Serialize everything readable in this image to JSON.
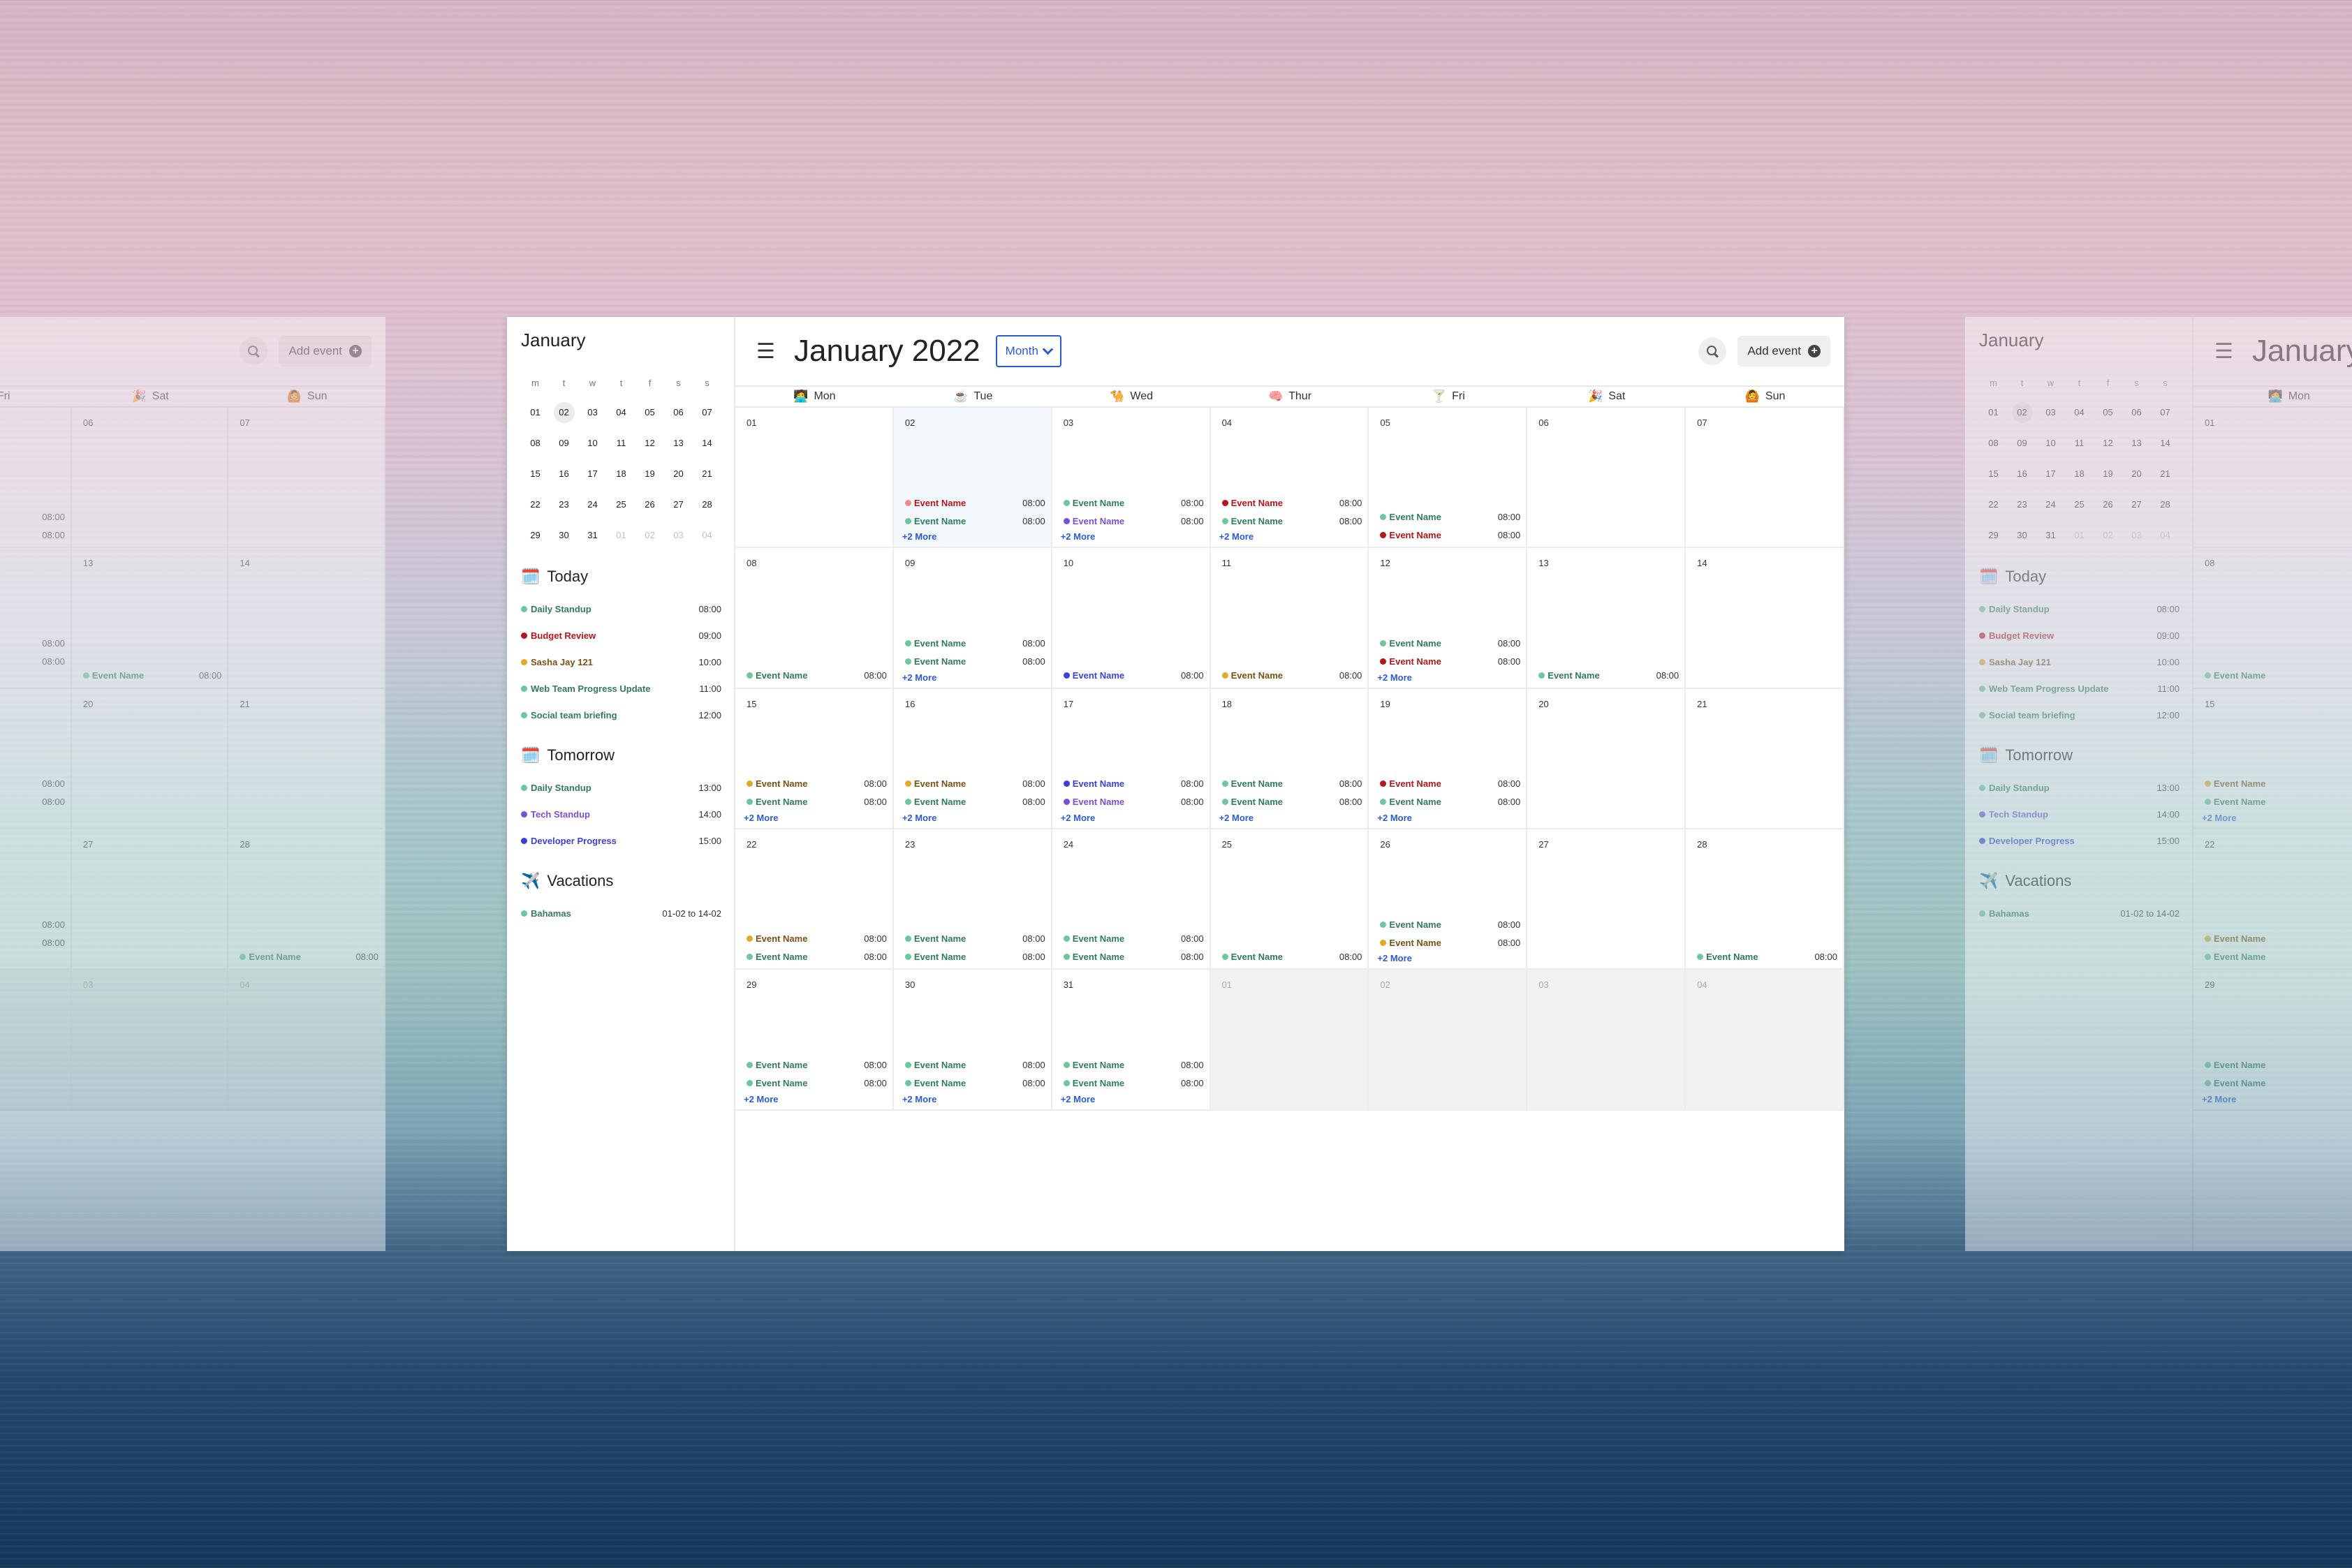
{
  "app": {
    "title": "January 2022",
    "view": "Month",
    "add_event_label": "Add event",
    "menu_icon": "hamburger-icon",
    "search_icon": "search-icon"
  },
  "colors": {
    "accent": "#2a5bd7",
    "green": "#6cc79a",
    "teal_text": "#2e7d5b",
    "red": "#b4161b",
    "pink": "#f08a8a",
    "purple": "#7a4fd6",
    "blue": "#3d3fd8",
    "yellow": "#e4a92b",
    "brown_text": "#7a5212"
  },
  "weekdays": [
    {
      "label": "Mon",
      "icon": "🧑‍💻"
    },
    {
      "label": "Tue",
      "icon": "☕"
    },
    {
      "label": "Wed",
      "icon": "🐪"
    },
    {
      "label": "Thur",
      "icon": "🧠"
    },
    {
      "label": "Fri",
      "icon": "🍸"
    },
    {
      "label": "Sat",
      "icon": "🎉"
    },
    {
      "label": "Sun",
      "icon": "🙆"
    }
  ],
  "mini_calendar": {
    "month": "January",
    "dow": [
      "m",
      "t",
      "w",
      "t",
      "f",
      "s",
      "s"
    ],
    "weeks": [
      [
        "01",
        "02",
        "03",
        "04",
        "05",
        "06",
        "07"
      ],
      [
        "08",
        "09",
        "10",
        "11",
        "12",
        "13",
        "14"
      ],
      [
        "15",
        "16",
        "17",
        "18",
        "19",
        "20",
        "21"
      ],
      [
        "22",
        "23",
        "24",
        "25",
        "26",
        "27",
        "28"
      ],
      [
        "29",
        "30",
        "31",
        "01",
        "02",
        "03",
        "04"
      ]
    ],
    "selected": "02"
  },
  "today": {
    "title": "Today",
    "icon": "🗓️",
    "items": [
      {
        "name": "Daily Standup",
        "time": "08:00",
        "color": "green"
      },
      {
        "name": "Budget Review",
        "time": "09:00",
        "color": "red"
      },
      {
        "name": "Sasha Jay 121",
        "time": "10:00",
        "color": "yellow"
      },
      {
        "name": "Web Team Progress Update",
        "time": "11:00",
        "color": "green"
      },
      {
        "name": "Social team briefing",
        "time": "12:00",
        "color": "green"
      }
    ]
  },
  "tomorrow": {
    "title": "Tomorrow",
    "icon": "🗓️",
    "items": [
      {
        "name": "Daily Standup",
        "time": "13:00",
        "color": "green"
      },
      {
        "name": "Tech Standup",
        "time": "14:00",
        "color": "purple"
      },
      {
        "name": "Developer Progress",
        "time": "15:00",
        "color": "blue"
      }
    ]
  },
  "vacations": {
    "title": "Vacations",
    "icon": "✈️",
    "items": [
      {
        "name": "Bahamas",
        "time": "01-02 to 14-02",
        "color": "green"
      }
    ]
  },
  "month_grid": [
    {
      "day": "01",
      "events": []
    },
    {
      "day": "02",
      "today": true,
      "events": [
        {
          "name": "Event Name",
          "time": "08:00",
          "color": "pink"
        },
        {
          "name": "Event Name",
          "time": "08:00",
          "color": "green"
        }
      ],
      "more": "+2 More"
    },
    {
      "day": "03",
      "events": [
        {
          "name": "Event Name",
          "time": "08:00",
          "color": "green"
        },
        {
          "name": "Event Name",
          "time": "08:00",
          "color": "purple"
        }
      ],
      "more": "+2 More"
    },
    {
      "day": "04",
      "events": [
        {
          "name": "Event Name",
          "time": "08:00",
          "color": "red"
        },
        {
          "name": "Event Name",
          "time": "08:00",
          "color": "green"
        }
      ],
      "more": "+2 More"
    },
    {
      "day": "05",
      "events": [
        {
          "name": "Event Name",
          "time": "08:00",
          "color": "green"
        },
        {
          "name": "Event Name",
          "time": "08:00",
          "color": "red"
        }
      ]
    },
    {
      "day": "06",
      "events": []
    },
    {
      "day": "07",
      "events": []
    },
    {
      "day": "08",
      "events": [
        {
          "name": "Event Name",
          "time": "08:00",
          "color": "green"
        }
      ]
    },
    {
      "day": "09",
      "events": [
        {
          "name": "Event Name",
          "time": "08:00",
          "color": "green"
        },
        {
          "name": "Event Name",
          "time": "08:00",
          "color": "green"
        }
      ],
      "more": "+2 More"
    },
    {
      "day": "10",
      "events": [
        {
          "name": "Event Name",
          "time": "08:00",
          "color": "blue"
        }
      ]
    },
    {
      "day": "11",
      "events": [
        {
          "name": "Event Name",
          "time": "08:00",
          "color": "yellow"
        }
      ]
    },
    {
      "day": "12",
      "events": [
        {
          "name": "Event Name",
          "time": "08:00",
          "color": "green"
        },
        {
          "name": "Event Name",
          "time": "08:00",
          "color": "red"
        }
      ],
      "more": "+2 More"
    },
    {
      "day": "13",
      "events": [
        {
          "name": "Event Name",
          "time": "08:00",
          "color": "green"
        }
      ]
    },
    {
      "day": "14",
      "events": []
    },
    {
      "day": "15",
      "events": [
        {
          "name": "Event Name",
          "time": "08:00",
          "color": "yellow"
        },
        {
          "name": "Event Name",
          "time": "08:00",
          "color": "green"
        }
      ],
      "more": "+2 More"
    },
    {
      "day": "16",
      "events": [
        {
          "name": "Event Name",
          "time": "08:00",
          "color": "yellow"
        },
        {
          "name": "Event Name",
          "time": "08:00",
          "color": "green"
        }
      ],
      "more": "+2 More"
    },
    {
      "day": "17",
      "events": [
        {
          "name": "Event Name",
          "time": "08:00",
          "color": "blue"
        },
        {
          "name": "Event Name",
          "time": "08:00",
          "color": "purple"
        }
      ],
      "more": "+2 More"
    },
    {
      "day": "18",
      "events": [
        {
          "name": "Event Name",
          "time": "08:00",
          "color": "green"
        },
        {
          "name": "Event Name",
          "time": "08:00",
          "color": "green"
        }
      ],
      "more": "+2 More"
    },
    {
      "day": "19",
      "events": [
        {
          "name": "Event Name",
          "time": "08:00",
          "color": "red"
        },
        {
          "name": "Event Name",
          "time": "08:00",
          "color": "green"
        }
      ],
      "more": "+2 More"
    },
    {
      "day": "20",
      "events": []
    },
    {
      "day": "21",
      "events": []
    },
    {
      "day": "22",
      "events": [
        {
          "name": "Event Name",
          "time": "08:00",
          "color": "yellow"
        },
        {
          "name": "Event Name",
          "time": "08:00",
          "color": "green"
        }
      ]
    },
    {
      "day": "23",
      "events": [
        {
          "name": "Event Name",
          "time": "08:00",
          "color": "green"
        },
        {
          "name": "Event Name",
          "time": "08:00",
          "color": "green"
        }
      ]
    },
    {
      "day": "24",
      "events": [
        {
          "name": "Event Name",
          "time": "08:00",
          "color": "green"
        },
        {
          "name": "Event Name",
          "time": "08:00",
          "color": "green"
        }
      ]
    },
    {
      "day": "25",
      "events": [
        {
          "name": "Event Name",
          "time": "08:00",
          "color": "green"
        }
      ]
    },
    {
      "day": "26",
      "events": [
        {
          "name": "Event Name",
          "time": "08:00",
          "color": "green"
        },
        {
          "name": "Event Name",
          "time": "08:00",
          "color": "yellow"
        }
      ],
      "more": "+2 More"
    },
    {
      "day": "27",
      "events": []
    },
    {
      "day": "28",
      "events": [
        {
          "name": "Event Name",
          "time": "08:00",
          "color": "green"
        }
      ]
    },
    {
      "day": "29",
      "events": [
        {
          "name": "Event Name",
          "time": "08:00",
          "color": "green"
        },
        {
          "name": "Event Name",
          "time": "08:00",
          "color": "green"
        }
      ],
      "more": "+2 More"
    },
    {
      "day": "30",
      "events": [
        {
          "name": "Event Name",
          "time": "08:00",
          "color": "green"
        },
        {
          "name": "Event Name",
          "time": "08:00",
          "color": "green"
        }
      ],
      "more": "+2 More"
    },
    {
      "day": "31",
      "events": [
        {
          "name": "Event Name",
          "time": "08:00",
          "color": "green"
        },
        {
          "name": "Event Name",
          "time": "08:00",
          "color": "green"
        }
      ],
      "more": "+2 More"
    },
    {
      "day": "01",
      "out": true,
      "events": []
    },
    {
      "day": "02",
      "out": true,
      "events": []
    },
    {
      "day": "03",
      "out": true,
      "events": []
    },
    {
      "day": "04",
      "out": true,
      "events": []
    }
  ]
}
